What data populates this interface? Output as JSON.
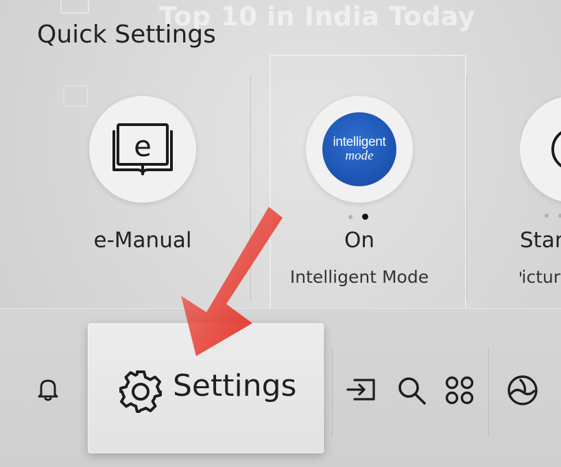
{
  "background": {
    "row_title": "Top 10 in India Today"
  },
  "quick_settings": {
    "title": "Quick Settings",
    "tiles": [
      {
        "label": "e-Manual",
        "icon": "e-manual-book-icon"
      },
      {
        "label": "On",
        "sublabel": "Intelligent Mode",
        "badge_line1": "intelligent",
        "badge_line2": "mode",
        "icon": "intelligent-mode-badge"
      },
      {
        "label": "Star",
        "sublabel": "Pictur",
        "icon": "picture-mode-icon"
      }
    ]
  },
  "bottom_bar": {
    "settings_label": "Settings",
    "icons": [
      "bell-icon",
      "gear-icon",
      "source-input-icon",
      "search-icon",
      "apps-grid-icon",
      "ambient-icon"
    ]
  },
  "colors": {
    "accent_blue": "#1c52b0",
    "arrow_red": "#e0271c"
  }
}
